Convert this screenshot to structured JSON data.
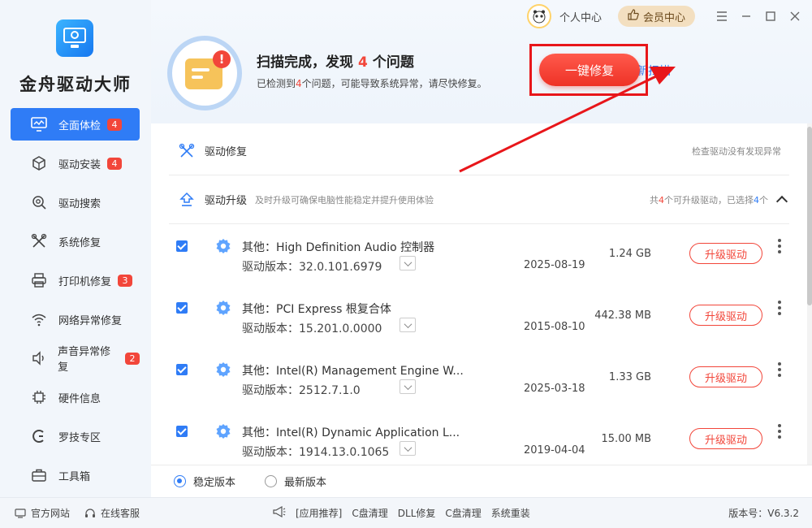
{
  "app": {
    "title": "金舟驱动大师"
  },
  "sidebar": {
    "items": [
      {
        "label": "全面体检",
        "badge": "4",
        "icon": "monitor-icon"
      },
      {
        "label": "驱动安装",
        "badge": "4",
        "icon": "package-icon"
      },
      {
        "label": "驱动搜索",
        "badge": "",
        "icon": "search-gear-icon"
      },
      {
        "label": "系统修复",
        "badge": "",
        "icon": "tools-icon"
      },
      {
        "label": "打印机修复",
        "badge": "3",
        "icon": "printer-icon"
      },
      {
        "label": "网络异常修复",
        "badge": "",
        "icon": "wifi-icon"
      },
      {
        "label": "声音异常修复",
        "badge": "2",
        "icon": "speaker-icon"
      },
      {
        "label": "硬件信息",
        "badge": "",
        "icon": "chip-icon"
      },
      {
        "label": "罗技专区",
        "badge": "",
        "icon": "logitech-icon"
      },
      {
        "label": "工具箱",
        "badge": "",
        "icon": "toolbox-icon"
      }
    ]
  },
  "topbar": {
    "personal": "个人中心",
    "vip": "会员中心"
  },
  "scan": {
    "title_pre": "扫描完成，发现",
    "title_num": "4",
    "title_post": "个问题",
    "sub_pre": "已检测到",
    "sub_num": "4",
    "sub_post": "个问题，可能导致系统异常，请尽快修复。",
    "rescan": "重新扫描",
    "fix_button": "一键修复"
  },
  "sections": {
    "repair": {
      "label": "驱动修复",
      "right": "检查驱动没有发现异常"
    },
    "upgrade": {
      "label": "驱动升级",
      "desc": "及时升级可确保电脑性能稳定并提升使用体验",
      "right_pre": "共",
      "right_num": "4",
      "right_mid": "个可升级驱动，已选择",
      "right_sel": "4",
      "right_post": "个"
    }
  },
  "drivers": [
    {
      "name": "其他：High Definition Audio 控制器",
      "version": "驱动版本：32.0.101.6979",
      "date": "2025-08-19",
      "size": "1.24 GB",
      "button": "升级驱动"
    },
    {
      "name": "其他：PCI Express 根复合体",
      "version": "驱动版本：15.201.0.0000",
      "date": "2015-08-10",
      "size": "442.38 MB",
      "button": "升级驱动"
    },
    {
      "name": "其他：Intel(R) Management Engine W...",
      "version": "驱动版本：2512.7.1.0",
      "date": "2025-03-18",
      "size": "1.33 GB",
      "button": "升级驱动"
    },
    {
      "name": "其他：Intel(R) Dynamic Application L...",
      "version": "驱动版本：1914.13.0.1065",
      "date": "2019-04-04",
      "size": "15.00 MB",
      "button": "升级驱动"
    }
  ],
  "version_options": {
    "stable": "稳定版本",
    "latest": "最新版本"
  },
  "footer": {
    "site": "官方网站",
    "service": "在线客服",
    "links": [
      "[应用推荐]",
      "C盘清理",
      "DLL修复",
      "C盘清理",
      "系统重装"
    ],
    "version": "版本号：V6.3.2"
  },
  "colors": {
    "accent": "#2f7cf6",
    "danger": "#f2463a",
    "highlight_frame": "#e8161a"
  }
}
